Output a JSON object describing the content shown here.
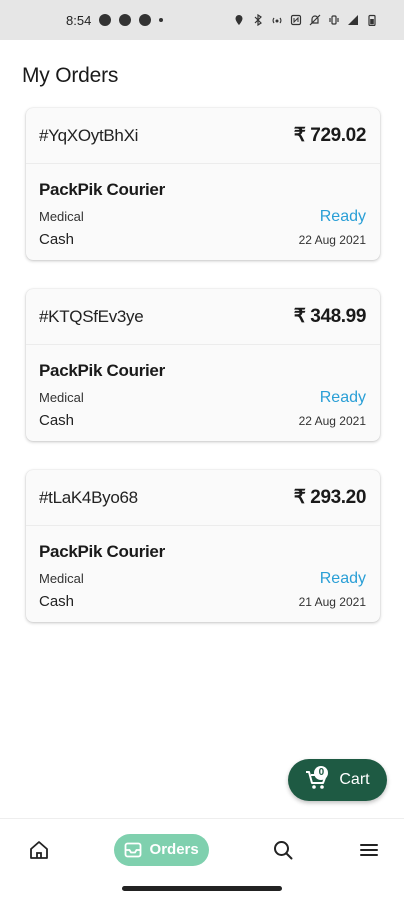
{
  "status_bar": {
    "time": "8:54"
  },
  "page": {
    "title": "My Orders"
  },
  "orders": [
    {
      "id": "#YqXOytBhXi",
      "amount": "₹ 729.02",
      "courier": "PackPik Courier",
      "category": "Medical",
      "status": "Ready",
      "payment": "Cash",
      "date": "22 Aug 2021"
    },
    {
      "id": "#KTQSfEv3ye",
      "amount": "₹ 348.99",
      "courier": "PackPik Courier",
      "category": "Medical",
      "status": "Ready",
      "payment": "Cash",
      "date": "22 Aug 2021"
    },
    {
      "id": "#tLaK4Byo68",
      "amount": "₹ 293.20",
      "courier": "PackPik Courier",
      "category": "Medical",
      "status": "Ready",
      "payment": "Cash",
      "date": "21 Aug 2021"
    }
  ],
  "cart": {
    "label": "Cart",
    "count": "0"
  },
  "bottom_nav": {
    "orders_label": "Orders"
  },
  "colors": {
    "brand_dark": "#1e5a43",
    "brand_light": "#7fd0ae",
    "status_ready": "#2a9fd6"
  }
}
